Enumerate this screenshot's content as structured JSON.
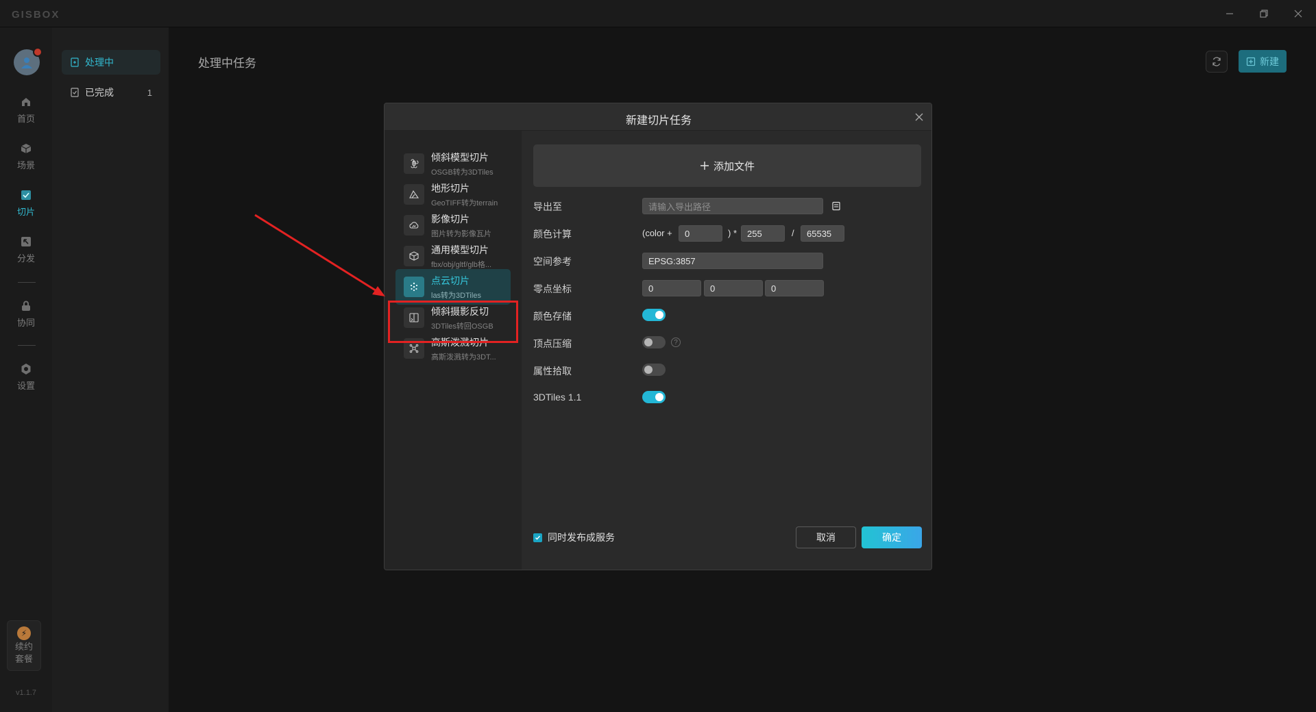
{
  "app": {
    "brand": "GISBOX",
    "version": "v1.1.7"
  },
  "rail": {
    "items": [
      {
        "label": "首页",
        "icon": "home-icon"
      },
      {
        "label": "场景",
        "icon": "cube-icon"
      },
      {
        "label": "切片",
        "icon": "slice-icon",
        "active": true
      },
      {
        "label": "分发",
        "icon": "distribute-icon"
      },
      {
        "label": "协同",
        "icon": "lock-icon"
      },
      {
        "label": "设置",
        "icon": "gear-icon"
      }
    ],
    "plan": {
      "line1": "续约",
      "line2": "套餐",
      "icon": "lightning-icon"
    }
  },
  "subside": {
    "items": [
      {
        "label": "处理中",
        "active": true
      },
      {
        "label": "已完成",
        "count": "1"
      }
    ]
  },
  "main": {
    "title": "处理中任务",
    "new_label": "新建"
  },
  "modal": {
    "title": "新建切片任务",
    "types": [
      {
        "name": "倾斜模型切片",
        "desc": "OSGB转为3DTiles",
        "icon": "command-icon"
      },
      {
        "name": "地形切片",
        "desc": "GeoTIFF转为terrain",
        "icon": "mountain-icon"
      },
      {
        "name": "影像切片",
        "desc": "图片转为影像瓦片",
        "icon": "cloud-image-icon"
      },
      {
        "name": "通用模型切片",
        "desc": "fbx/obj/gltf/glb格...",
        "icon": "box-icon"
      },
      {
        "name": "点云切片",
        "desc": "las转为3DTiles",
        "icon": "pointcloud-icon",
        "active": true
      },
      {
        "name": "倾斜摄影反切",
        "desc": "3DTiles转回OSGB",
        "icon": "reverse-icon"
      },
      {
        "name": "高斯泼溅切片",
        "desc": "高斯泼溅转为3DT...",
        "icon": "molecule-icon"
      }
    ],
    "add_file": "添加文件",
    "form": {
      "export_label": "导出至",
      "export_placeholder": "请输入导出路径",
      "color_calc_label": "颜色计算",
      "color_prefix": "(color +",
      "color_offset": "0",
      "color_mult_sym": ") *",
      "color_mult": "255",
      "color_div_sym": "/",
      "color_div": "65535",
      "srs_label": "空间参考",
      "srs_value": "EPSG:3857",
      "origin_label": "零点坐标",
      "origin_x": "0",
      "origin_y": "0",
      "origin_z": "0",
      "color_store_label": "颜色存储",
      "color_store_on": true,
      "vertex_compress_label": "顶点压缩",
      "vertex_compress_on": false,
      "attr_pick_label": "属性拾取",
      "attr_pick_on": false,
      "tiles11_label": "3DTiles 1.1",
      "tiles11_on": true
    },
    "publish_label": "同时发布成服务",
    "publish_checked": true,
    "cancel_label": "取消",
    "ok_label": "确定"
  },
  "colors": {
    "accent": "#32b9cf",
    "annotation": "#e32222"
  }
}
